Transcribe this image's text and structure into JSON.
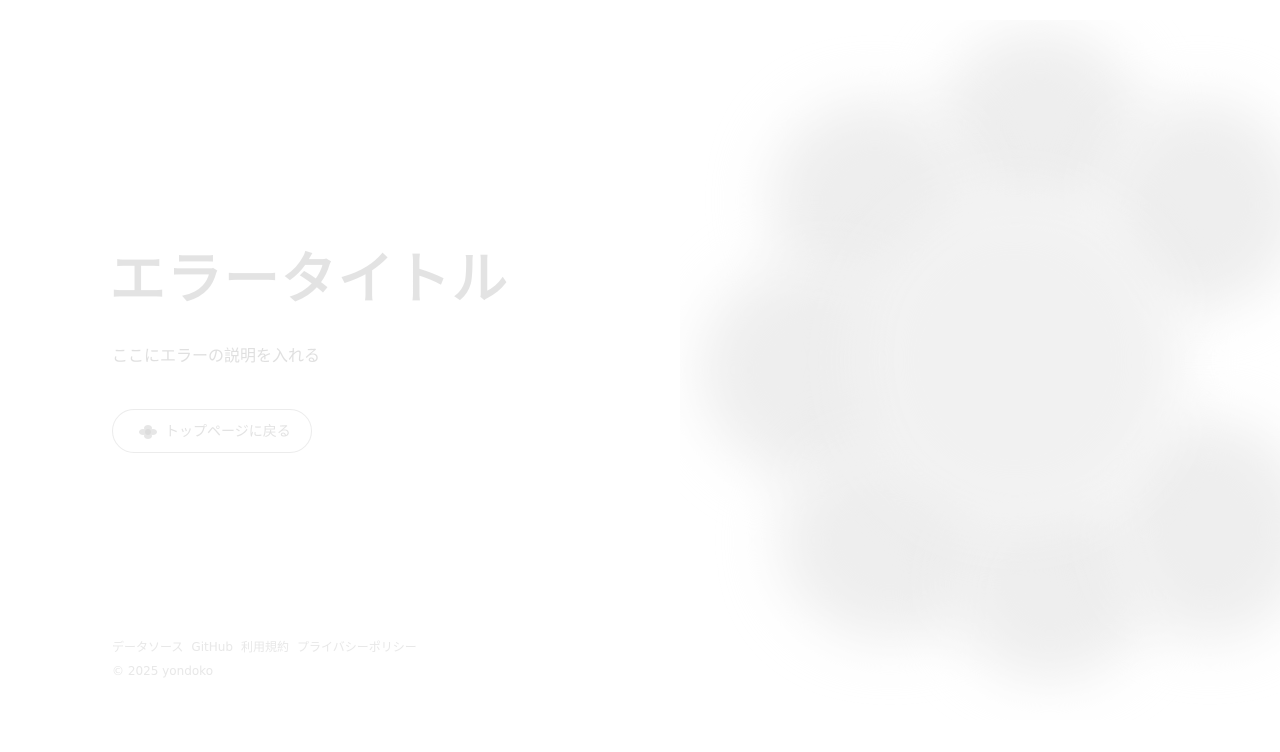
{
  "error": {
    "title": "エラータイトル",
    "description": "ここにエラーの説明を入れる"
  },
  "actions": {
    "back_label": "トップページに戻る",
    "back_icon": "flower-icon"
  },
  "footer": {
    "links": [
      "データソース",
      "GitHub",
      "利用規約",
      "プライバシーポリシー"
    ],
    "copyright": "© 2025 yondoko"
  },
  "colors": {
    "title": "#e3e3e3",
    "text": "#e0e0e0",
    "background_shape": "#eeeeee",
    "button_border": "#ececec"
  }
}
